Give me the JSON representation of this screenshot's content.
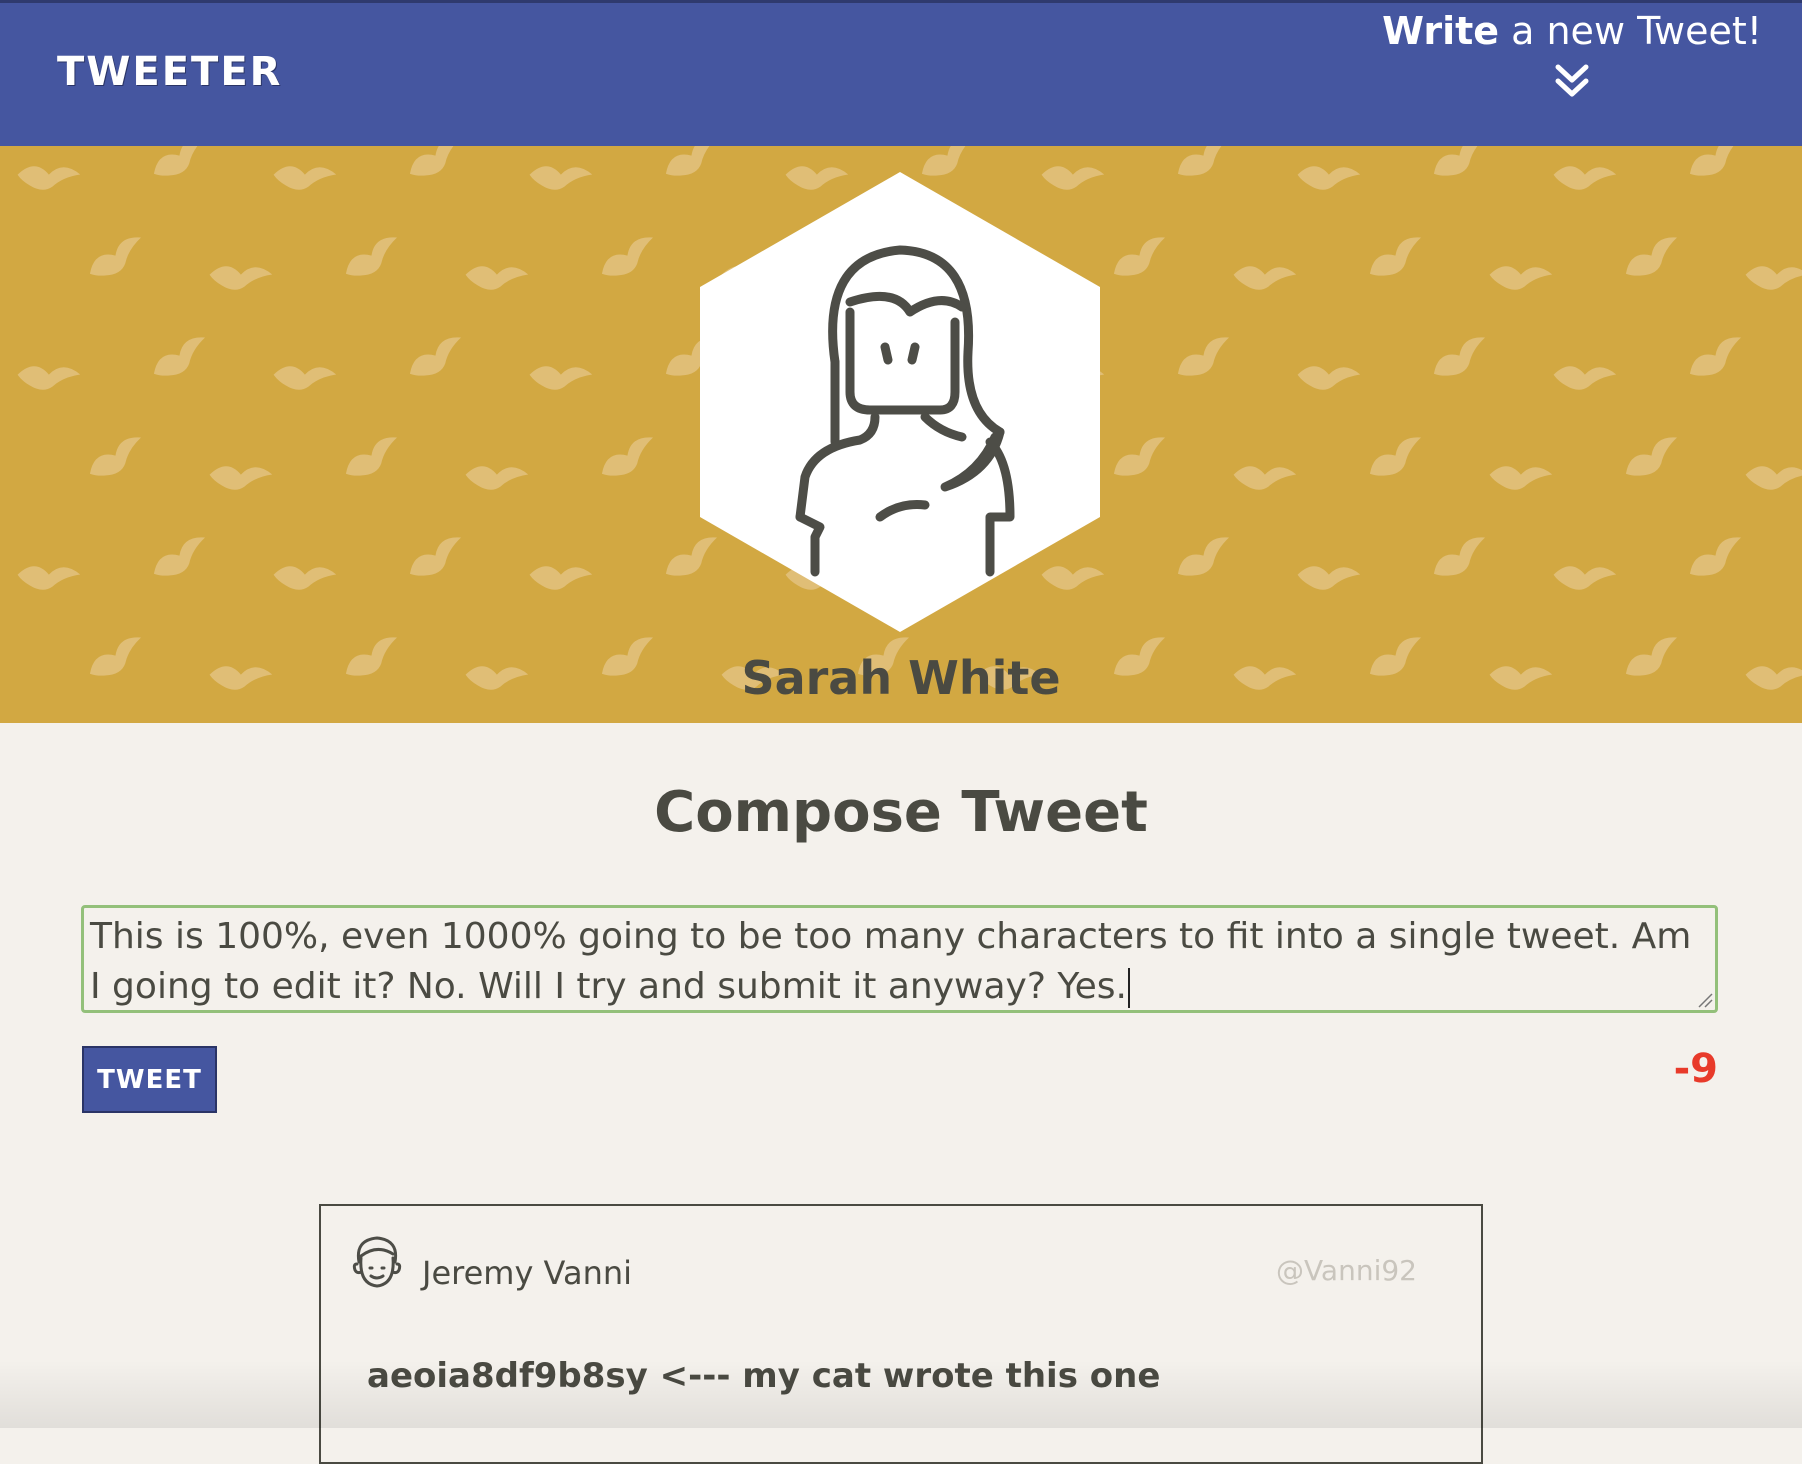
{
  "nav": {
    "brand": "TWEETER",
    "write_bold": "Write",
    "write_rest": " a new Tweet!",
    "chevron_icon": "double-chevron-down-icon"
  },
  "profile": {
    "name": "Sarah White",
    "avatar_icon": "woman-avatar-icon",
    "banner_color": "#d2a842"
  },
  "compose": {
    "title": "Compose Tweet",
    "text": "This is 100%, even 1000% going to be too many characters to fit into a single tweet. Am I going to edit it? No. Will I try and submit it anyway? Yes.",
    "button_label": "TWEET",
    "counter": "-9",
    "counter_color": "#e83a2a"
  },
  "tweets": [
    {
      "name": "Jeremy Vanni",
      "handle": "@Vanni92",
      "body": "aeoia8df9b8sy <--- my cat wrote this one",
      "avatar_icon": "man-avatar-icon"
    }
  ],
  "colors": {
    "nav": "#4556a0",
    "background": "#f4f1ec",
    "text": "#4a4a42"
  }
}
